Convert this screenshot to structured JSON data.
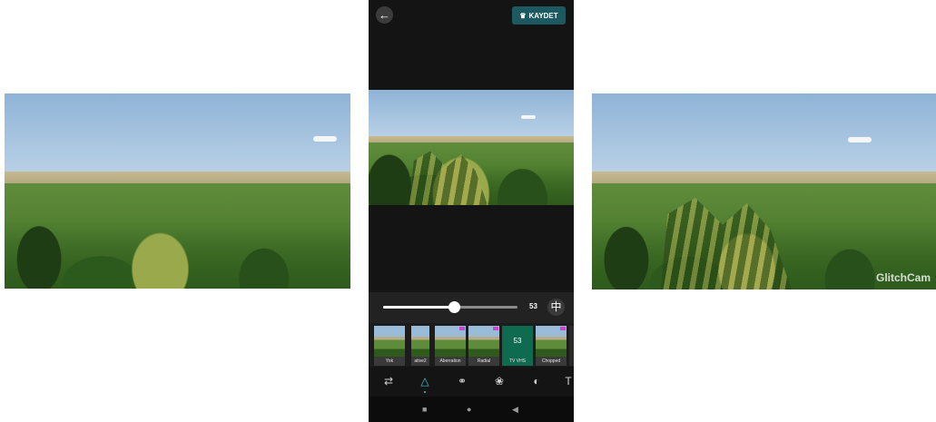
{
  "header": {
    "save_label": "KAYDET"
  },
  "slider": {
    "value": "53",
    "fraction": 0.53
  },
  "filters": [
    {
      "label": "Yok",
      "pro": false,
      "selected": false
    },
    {
      "label": "ative2",
      "pro": false,
      "selected": false
    },
    {
      "label": "Aberration",
      "pro": true,
      "selected": false
    },
    {
      "label": "Radial",
      "pro": true,
      "selected": false
    },
    {
      "label": "TV VHS",
      "pro": false,
      "selected": true,
      "value": "53"
    },
    {
      "label": "Chopped",
      "pro": true,
      "selected": false
    }
  ],
  "watermark": "GlitchCam",
  "tools": [
    "adjust-icon",
    "effects-icon",
    "color-filter-icon",
    "glitch-icon",
    "texture-icon",
    "text-icon"
  ],
  "colors": {
    "accent": "#3fc4d8",
    "save_button": "#1c5961",
    "selected_filter": "#0f6b4f",
    "pro_badge": "#c14acf"
  }
}
